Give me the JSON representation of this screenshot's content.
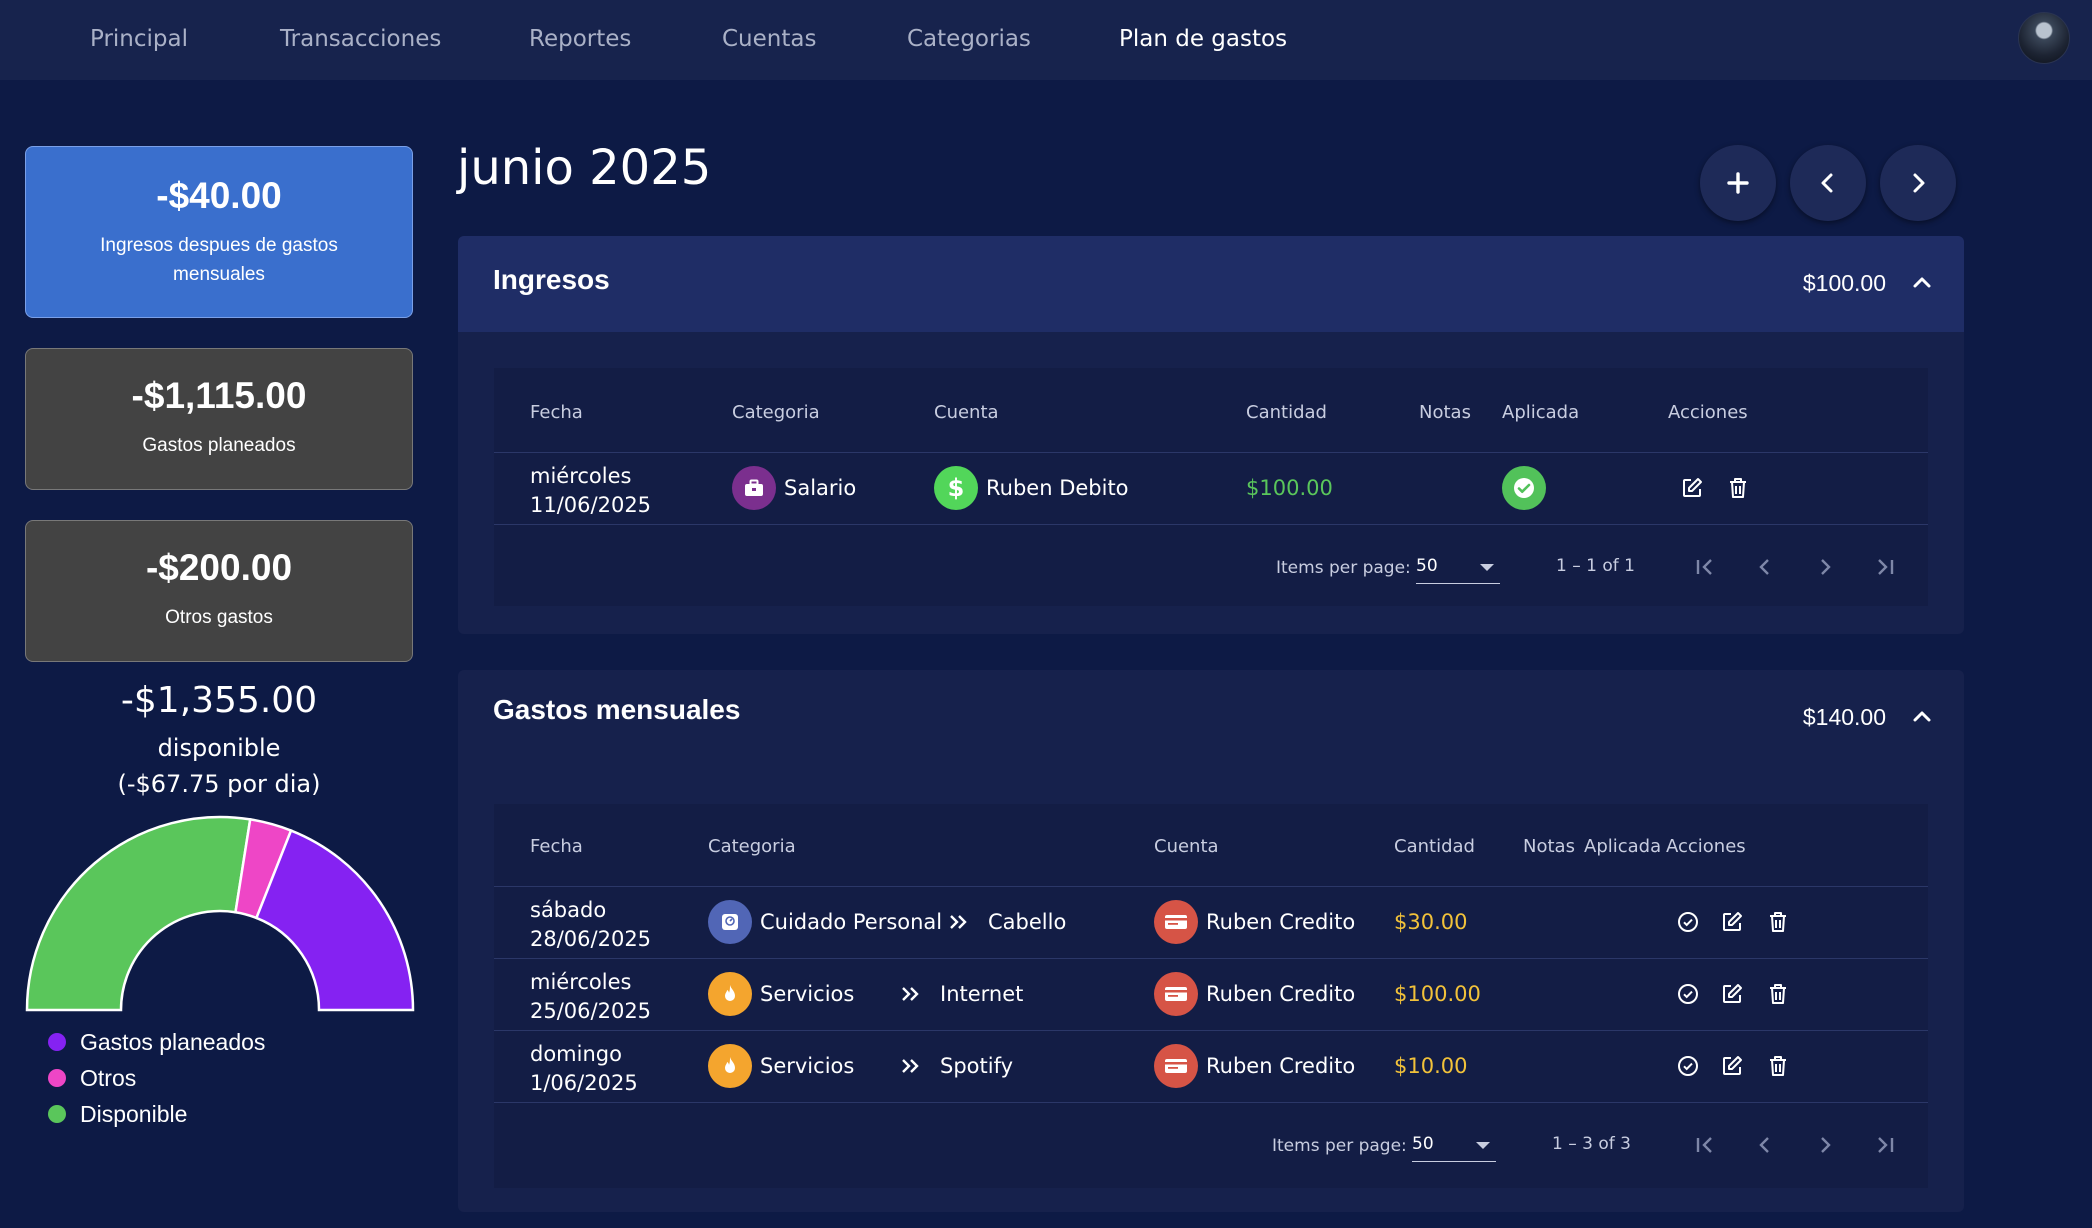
{
  "nav": {
    "items": [
      "Principal",
      "Transacciones",
      "Reportes",
      "Cuentas",
      "Categorias",
      "Plan de gastos"
    ],
    "active": "Plan de gastos"
  },
  "summary": {
    "income_after": {
      "amount": "-$40.00",
      "label_line1": "Ingresos despues de gastos",
      "label_line2": "mensuales"
    },
    "planned": {
      "amount": "-$1,115.00",
      "label": "Gastos planeados"
    },
    "others": {
      "amount": "-$200.00",
      "label": "Otros gastos"
    },
    "available": {
      "amount": "-$1,355.00",
      "label": "disponible",
      "per_day": "(-$67.75 por dia)"
    }
  },
  "chart_data": {
    "type": "pie",
    "style": "half-doughnut",
    "series": [
      {
        "name": "Gastos planeados",
        "color": "#8522f2",
        "fraction": 0.38
      },
      {
        "name": "Otros",
        "color": "#ee46c6",
        "fraction": 0.07
      },
      {
        "name": "Disponible",
        "color": "#5ac65b",
        "fraction": 0.55
      }
    ],
    "legend_position": "bottom-left"
  },
  "main": {
    "month_title": "junio 2025",
    "buttons": {
      "add": "plus-icon",
      "prev": "chevron-left-icon",
      "next": "chevron-right-icon"
    }
  },
  "ingresos": {
    "title": "Ingresos",
    "total": "$100.00",
    "headers": [
      "Fecha",
      "Categoria",
      "Cuenta",
      "Cantidad",
      "Notas",
      "Aplicada",
      "Acciones"
    ],
    "rows": [
      {
        "day": "miércoles",
        "date": "11/06/2025",
        "category": "Salario",
        "category_icon": "briefcase-icon",
        "category_color": "#7b2f8e",
        "account": "Ruben Debito",
        "account_icon": "dollar-icon",
        "account_color": "#52d65a",
        "amount": "$100.00",
        "amount_color": "#5ac65b",
        "applied": true
      }
    ],
    "pager": {
      "label": "Items per page:",
      "size": "50",
      "range": "1 – 1 of 1"
    }
  },
  "gastos": {
    "title": "Gastos mensuales",
    "total": "$140.00",
    "headers": [
      "Fecha",
      "Categoria",
      "Cuenta",
      "Cantidad",
      "Notas",
      "Aplicada",
      "Acciones"
    ],
    "rows": [
      {
        "day": "sábado",
        "date": "28/06/2025",
        "category": "Cuidado Personal",
        "category_icon": "scale-icon",
        "category_color": "#5166b6",
        "subcategory": "Cabello",
        "account": "Ruben Credito",
        "account_icon": "credit-card-icon",
        "account_color": "#d65446",
        "amount": "$30.00",
        "amount_color": "#f2c23a"
      },
      {
        "day": "miércoles",
        "date": "25/06/2025",
        "category": "Servicios",
        "category_icon": "flame-icon",
        "category_color": "#f4a52e",
        "subcategory": "Internet",
        "account": "Ruben Credito",
        "account_icon": "credit-card-icon",
        "account_color": "#d65446",
        "amount": "$100.00",
        "amount_color": "#f2c23a"
      },
      {
        "day": "domingo",
        "date": "1/06/2025",
        "category": "Servicios",
        "category_icon": "flame-icon",
        "category_color": "#f4a52e",
        "subcategory": "Spotify",
        "account": "Ruben Credito",
        "account_icon": "credit-card-icon",
        "account_color": "#d65446",
        "amount": "$10.00",
        "amount_color": "#f2c23a"
      }
    ],
    "pager": {
      "label": "Items per page:",
      "size": "50",
      "range": "1 – 3 of 3"
    }
  }
}
